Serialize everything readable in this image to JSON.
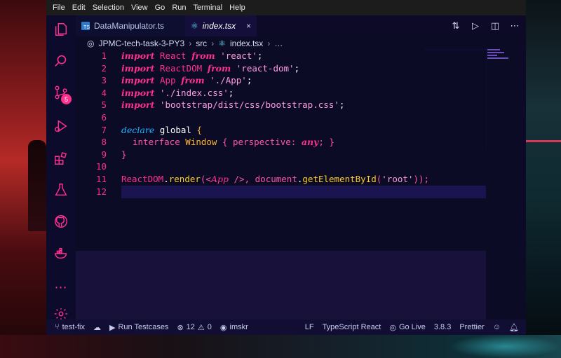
{
  "menu": [
    "File",
    "Edit",
    "Selection",
    "View",
    "Go",
    "Run",
    "Terminal",
    "Help"
  ],
  "activity_bar": {
    "source_control_badge": "5"
  },
  "tabs": [
    {
      "label": "DataManipulator.ts",
      "active": false
    },
    {
      "label": "index.tsx",
      "active": true,
      "close": "×"
    }
  ],
  "tab_actions": [
    "⇅",
    "▷",
    "◫",
    "⋯"
  ],
  "breadcrumbs": {
    "root": "JPMC-tech-task-3-PY3",
    "folder": "src",
    "file": "index.tsx",
    "tail": "…",
    "sep": "›"
  },
  "code": {
    "line_numbers": [
      "1",
      "2",
      "3",
      "4",
      "5",
      "6",
      "7",
      "8",
      "9",
      "10",
      "11",
      "12"
    ],
    "l1": {
      "kw": "import",
      "id": "React",
      "from": "from",
      "str": "'react'",
      "end": ";"
    },
    "l2": {
      "kw": "import",
      "id": "ReactDOM",
      "from": "from",
      "str": "'react-dom'",
      "end": ";"
    },
    "l3": {
      "kw": "import",
      "id": "App",
      "from": "from",
      "str": "'./App'",
      "end": ";"
    },
    "l4": {
      "kw": "import",
      "str": "'./index.css'",
      "end": ";"
    },
    "l5": {
      "kw": "import",
      "str": "'bootstrap/dist/css/bootstrap.css'",
      "end": ";"
    },
    "l7": {
      "kw": "declare",
      "id": "global",
      "brace": "{"
    },
    "l8": {
      "kw": "interface",
      "ty": "Window",
      "open": "{",
      "prop": "perspective:",
      "any": "any",
      "close": "; }"
    },
    "l9": {
      "brace": "}"
    },
    "l11": {
      "obj": "ReactDOM",
      "dot": ".",
      "fn": "render",
      "p1": "(<",
      "jsx": "App",
      "p2": " />,",
      "doc": "document",
      "fn2": "getElementById",
      "p3": "(",
      "str": "'root'",
      "p4": "));"
    }
  },
  "statusbar": {
    "branch": "test-fix",
    "run_testcases": "Run Testcases",
    "errors": "12",
    "warnings": "0",
    "user": "imskr",
    "eol": "LF",
    "language": "TypeScript React",
    "go_live": "Go Live",
    "version": "3.8.3",
    "formatter": "Prettier"
  },
  "colors": {
    "accent": "#ff2f8e",
    "background": "#0b0b26",
    "string": "#ff9ce0",
    "type": "#ffb52d",
    "keyword_alt": "#1fb4ff"
  }
}
